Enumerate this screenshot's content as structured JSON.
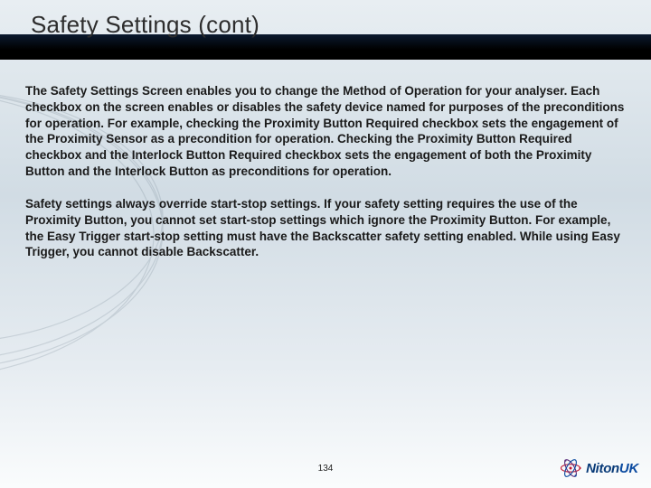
{
  "title": "Safety Settings (cont)",
  "paragraphs": {
    "p1": "The Safety Settings Screen enables you to change the Method of Operation for your analyser. Each checkbox on the screen enables or disables the safety device named for purposes of the preconditions for operation. For example, checking the Proximity Button Required checkbox sets the engagement of the Proximity Sensor as a precondition for operation. Checking the Proximity Button Required checkbox and the Interlock Button Required checkbox sets the engagement of both the Proximity Button and the Interlock Button as preconditions for operation.",
    "p2": "Safety settings always override start-stop settings. If your safety setting requires the use of the Proximity Button, you cannot set start-stop settings which ignore the Proximity Button. For example, the Easy Trigger start-stop setting must have the Backscatter safety setting enabled. While using Easy Trigger, you cannot disable Backscatter."
  },
  "page_number": "134",
  "logo": {
    "brand": "Niton",
    "suffix": "UK"
  }
}
